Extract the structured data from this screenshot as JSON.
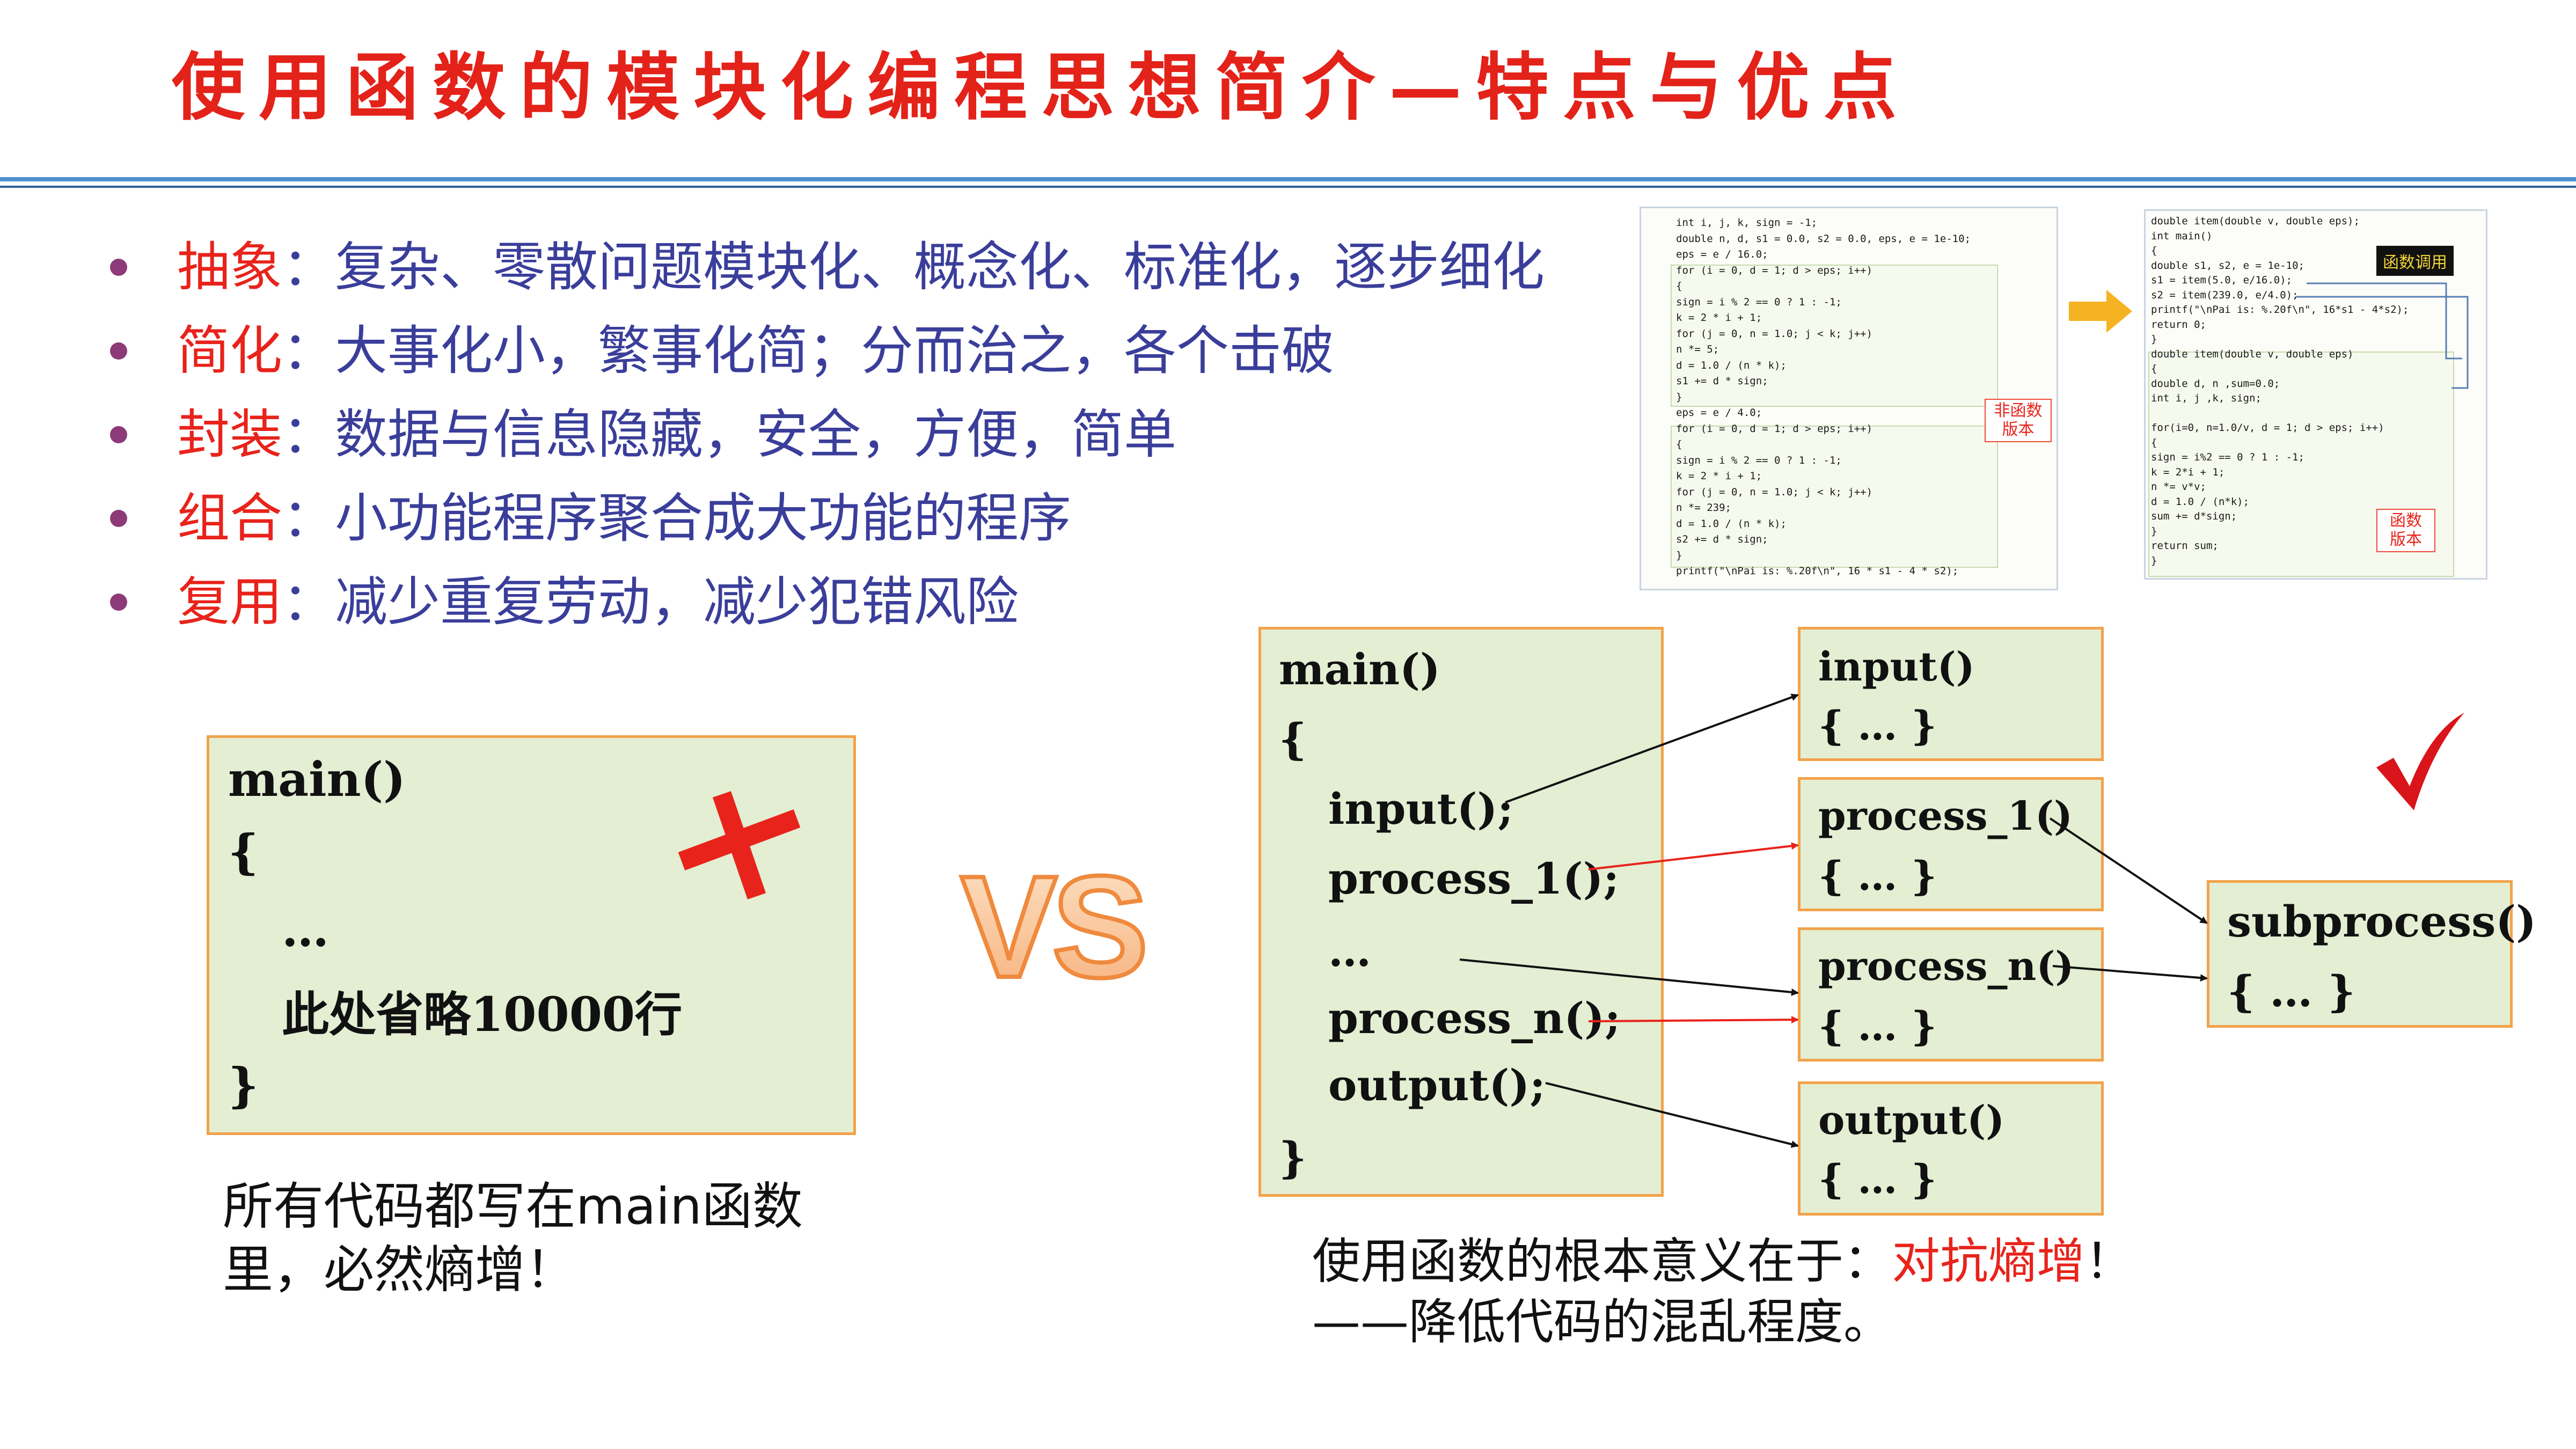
{
  "title": "使用函数的模块化编程思想简介—特点与优点",
  "bullets": [
    {
      "term": "抽象",
      "text": "：复杂、零散问题模块化、概念化、标准化，逐步细化"
    },
    {
      "term": "简化",
      "text": "：大事化小，繁事化简；分而治之，各个击破"
    },
    {
      "term": "封装",
      "text": "：数据与信息隐藏，安全，方便，简单"
    },
    {
      "term": "组合",
      "text": "：小功能程序聚合成大功能的程序"
    },
    {
      "term": "复用",
      "text": "：减少重复劳动，减少犯错风险"
    }
  ],
  "left_code": {
    "lines": [
      "main()",
      "{",
      "…",
      "此处省略10000行",
      "}"
    ]
  },
  "left_caption": [
    "所有代码都写在main函数",
    "里，必然熵增！"
  ],
  "vs_label": "VS",
  "right_main": {
    "lines": [
      "main()",
      "{",
      "input();",
      "process_1();",
      "…",
      "process_n();",
      "output();",
      "}"
    ]
  },
  "functions": [
    {
      "name": "input()",
      "body": "{ … }"
    },
    {
      "name": "process_1()",
      "body": "{ … }"
    },
    {
      "name": "process_n()",
      "body": "{ … }"
    },
    {
      "name": "output()",
      "body": "{ … }"
    }
  ],
  "subprocess": {
    "name": "subprocess()",
    "body": "{ … }"
  },
  "right_caption": {
    "line1_prefix": "使用函数的根本意义在于：",
    "line1_highlight": "对抗熵增",
    "line1_suffix": "！",
    "line2": "——降低代码的混乱程度。"
  },
  "code_shot_left": {
    "lines": [
      "int i, j, k, sign = -1;",
      "double n, d, s1 = 0.0, s2 = 0.0, eps, e = 1e-10;",
      "eps = e / 16.0;",
      "for (i = 0, d = 1; d > eps; i++)",
      "{",
      "    sign = i % 2 == 0 ? 1 : -1;",
      "    k = 2 * i + 1;",
      "    for (j = 0, n = 1.0; j < k; j++)",
      "        n *= 5;",
      "    d = 1.0 / (n * k);",
      "    s1 += d * sign;",
      "}",
      "eps = e / 4.0;",
      "for (i = 0, d = 1; d > eps; i++)",
      "{",
      "    sign = i % 2 == 0 ? 1 : -1;",
      "    k = 2 * i + 1;",
      "    for (j = 0, n = 1.0; j < k; j++)",
      "        n *= 239;",
      "    d = 1.0 / (n * k);",
      "    s2 += d * sign;",
      "}",
      "printf(\"\\nPai is: %.20f\\n\", 16 * s1 - 4 * s2);"
    ],
    "tag": [
      "非函数",
      "版本"
    ]
  },
  "code_shot_right": {
    "lines": [
      "double item(double v, double eps);",
      "int main()",
      "{",
      "    double s1, s2, e = 1e-10;",
      "    s1 = item(5.0, e/16.0);",
      "    s2 = item(239.0, e/4.0);",
      "    printf(\"\\nPai is: %.20f\\n\", 16*s1 - 4*s2);",
      "    return 0;",
      "}",
      "double item(double v, double eps)",
      "{",
      "    double d, n ,sum=0.0;",
      "    int i, j ,k, sign;",
      "",
      "    for(i=0, n=1.0/v, d = 1; d > eps; i++)",
      "    {",
      "        sign = i%2 == 0 ? 1 : -1;",
      "        k = 2*i + 1;",
      "        n *= v*v;",
      "        d = 1.0 / (n*k);",
      "        sum += d*sign;",
      "    }",
      "    return sum;",
      "}"
    ],
    "tag_call": "函数调用",
    "tag": [
      "函数",
      "版本"
    ]
  },
  "colors": {
    "title": "#e32219",
    "term": "#e8231b",
    "bullet_text": "#3a3e9a",
    "box_fill": "#e3eed3",
    "box_border": "#f2a24a",
    "arrow_red": "#e8231b"
  }
}
